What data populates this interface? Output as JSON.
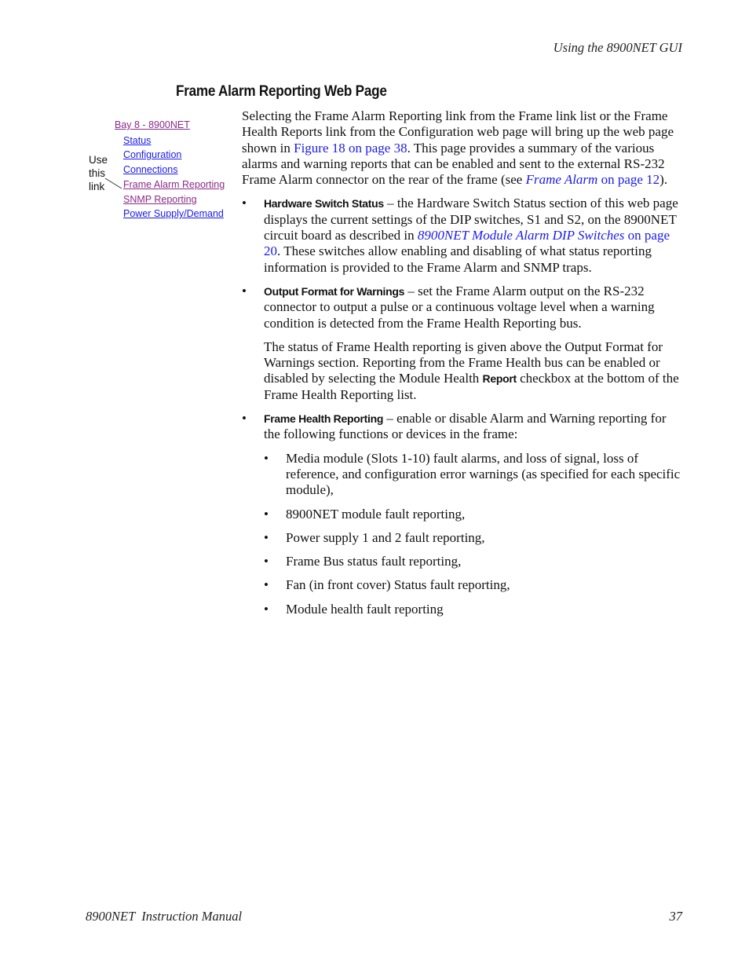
{
  "header": {
    "running_head": "Using the 8900NET GUI"
  },
  "section": {
    "title": "Frame Alarm Reporting Web Page"
  },
  "figure": {
    "links": [
      {
        "label": "Bay 8 - 8900NET",
        "state": "visited"
      },
      {
        "label": "Status",
        "state": "unvisited"
      },
      {
        "label": "Configuration",
        "state": "unvisited"
      },
      {
        "label": "Connections",
        "state": "unvisited"
      },
      {
        "label": "Frame Alarm Reporting",
        "state": "visited"
      },
      {
        "label": "SNMP Reporting",
        "state": "visited"
      },
      {
        "label": "Power Supply/Demand",
        "state": "unvisited"
      }
    ],
    "callout": {
      "line1": "Use",
      "line2": "this",
      "line3": "link"
    }
  },
  "intro": {
    "text1": "Selecting the Frame Alarm Reporting link from the Frame link list or the Frame Health Reports link from the Configuration web page will bring up the web page shown in ",
    "link1": "Figure 18 on page 38",
    "text2": ". This page provides a summary of the various alarms and warning reports that can be enabled and sent to the external RS-232 Frame Alarm connector on the rear of the frame (see ",
    "link2_italic": "Frame Alarm",
    "link2_rest": " on page 12",
    "text3": ")."
  },
  "bullets": [
    {
      "runin": "Hardware Switch Status",
      "text1": " – the Hardware Switch Status section of this web page displays the current settings of the DIP switches, S1 and S2, on the 8900NET circuit board as described in ",
      "link_italic": "8900NET Module Alarm DIP Switches",
      "link_rest": " on page 20",
      "text2": ". These switches allow enabling and disabling of what status reporting information is provided to the Frame Alarm and SNMP traps."
    },
    {
      "runin": "Output Format for Warnings",
      "text1": " – set the Frame Alarm output on the RS-232 connector to output a pulse or a continuous voltage level when a warning condition is detected from the Frame Health Reporting bus.",
      "para2_a": "The status of Frame Health reporting is given above the Output Format for Warnings section. Reporting from the Frame Health bus can be enabled or disabled by selecting the Module Health ",
      "para2_bold": "Report",
      "para2_b": " checkbox at the bottom of the Frame Health Reporting list."
    },
    {
      "runin": "Frame Health Reporting",
      "text1": " – enable or disable Alarm and Warning reporting for the following functions or devices in the frame:",
      "sub_items": [
        "Media module (Slots 1-10) fault alarms, and loss of signal, loss of reference, and configuration error warnings (as specified for each specific module),",
        "8900NET module fault reporting,",
        "Power supply 1 and 2 fault reporting,",
        "Frame Bus status fault reporting,",
        "Fan (in front cover) Status fault reporting,",
        "Module health fault reporting"
      ]
    }
  ],
  "footer": {
    "manual_title": "8900NET  Instruction Manual",
    "page_number": "37"
  },
  "colors": {
    "link_blue": "#1a1aee",
    "link_visited": "#8b2a8b",
    "text": "#111111"
  }
}
